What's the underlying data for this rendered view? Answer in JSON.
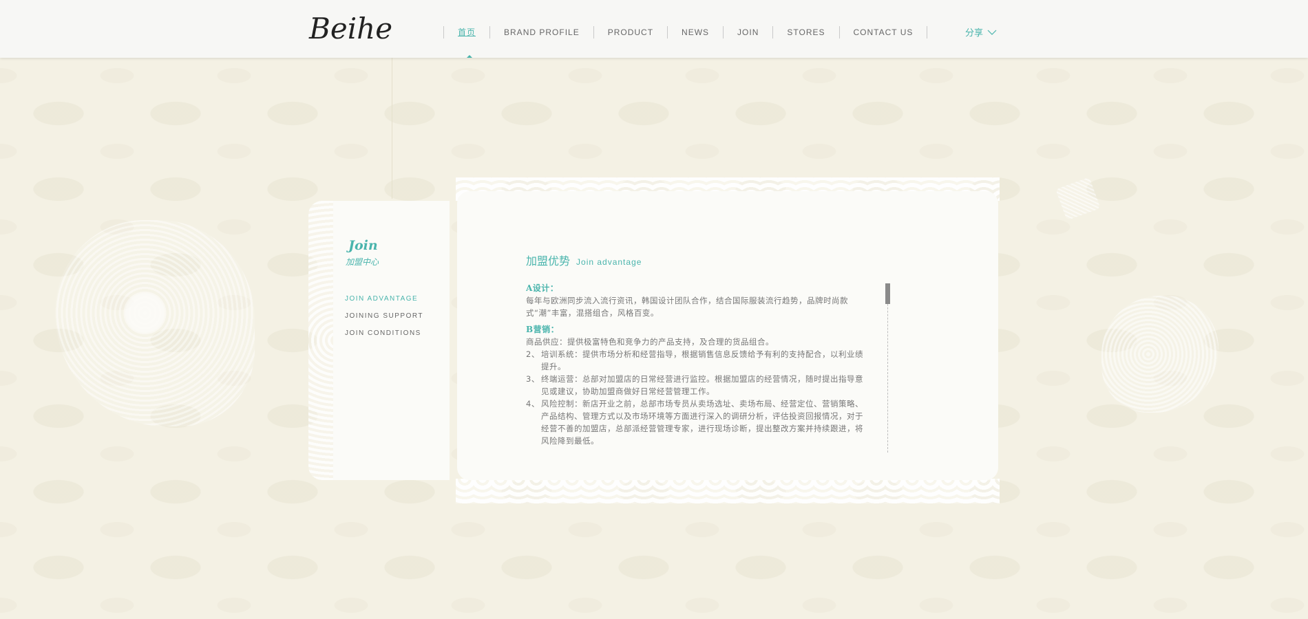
{
  "header": {
    "logo": "Beihe",
    "nav": [
      {
        "label": "首页",
        "active": true
      },
      {
        "label": "BRAND PROFILE",
        "active": false
      },
      {
        "label": "PRODUCT",
        "active": false
      },
      {
        "label": "NEWS",
        "active": false
      },
      {
        "label": "JOIN",
        "active": false
      },
      {
        "label": "STORES",
        "active": false
      },
      {
        "label": "CONTACT US",
        "active": false
      }
    ],
    "share_label": "分享"
  },
  "sidebar": {
    "title": "Join",
    "subtitle": "加盟中心",
    "items": [
      {
        "label": "JOIN ADVANTAGE",
        "active": true
      },
      {
        "label": "JOINING SUPPORT",
        "active": false
      },
      {
        "label": "JOIN CONDITIONS",
        "active": false
      }
    ]
  },
  "content": {
    "title_cn": "加盟优势",
    "title_en": "Join advantage",
    "sections": [
      {
        "heading": "A设计：",
        "text": "每年与欧洲同步流入流行资讯，韩国设计团队合作，结合国际服装流行趋势，品牌时尚款式“潮”丰富，混搭组合，风格百变。"
      },
      {
        "heading": "B营销：",
        "intro": "商品供应：提供极富特色和竞争力的产品支持，及合理的货品组合。",
        "items": [
          {
            "num": "2、",
            "text": "培训系统：提供市场分析和经营指导，根据销售信息反馈给予有利的支持配合，以利业绩提升。"
          },
          {
            "num": "3、",
            "text": "终端运营：总部对加盟店的日常经营进行监控。根据加盟店的经营情况，随时提出指导意见或建议，协助加盟商做好日常经营管理工作。"
          },
          {
            "num": "4、",
            "text": "风险控制：新店开业之前，总部市场专员从卖场选址、卖场布局、经营定位、营销策略、产品结构、管理方式以及市场环境等方面进行深入的调研分析，评估投资回报情况，对于经营不善的加盟店，总部派经营管理专家，进行现场诊断，提出整改方案并持续跟进，将风险降到最低。"
          }
        ]
      }
    ]
  },
  "colors": {
    "accent": "#49b4ac",
    "background": "#f4f1e4",
    "panel": "#fbfbf8",
    "text": "#777777"
  }
}
